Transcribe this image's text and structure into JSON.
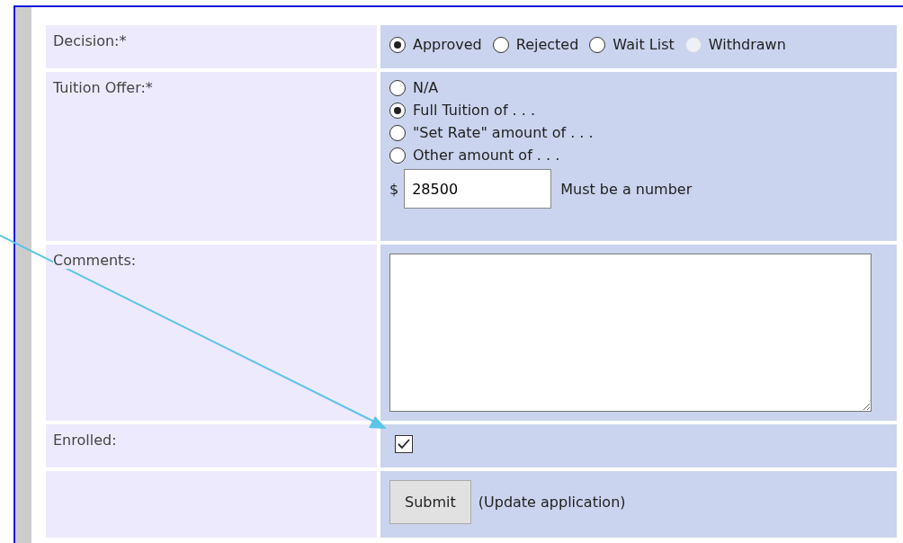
{
  "form": {
    "rows": [
      {
        "kind": "radios",
        "label": "Decision:*",
        "options": [
          {
            "label": "Approved",
            "selected": true,
            "disabled": false
          },
          {
            "label": "Rejected",
            "selected": false,
            "disabled": false
          },
          {
            "label": "Wait List",
            "selected": false,
            "disabled": false
          },
          {
            "label": "Withdrawn",
            "selected": false,
            "disabled": true
          }
        ]
      },
      {
        "kind": "tuition",
        "label": "Tuition Offer:*",
        "options": [
          {
            "label": "N/A",
            "selected": false
          },
          {
            "label": "Full Tuition of . . .",
            "selected": true
          },
          {
            "label": "\"Set Rate\" amount of . . .",
            "selected": false
          },
          {
            "label": "Other amount of . . .",
            "selected": false
          }
        ],
        "currency": "$",
        "amount": "28500",
        "hint": "Must be a number"
      },
      {
        "kind": "textarea",
        "label": "Comments:"
      },
      {
        "kind": "checkbox",
        "label": "Enrolled:",
        "checked": true
      },
      {
        "kind": "submit",
        "button": "Submit",
        "note": "(Update application)"
      }
    ]
  }
}
